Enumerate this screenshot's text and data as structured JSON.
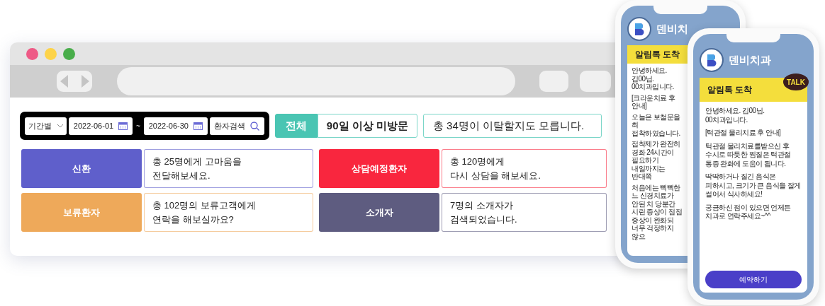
{
  "filter": {
    "period_select": "기간별",
    "start_date": "2022-06-01",
    "separator": "~",
    "end_date": "2022-06-30",
    "search_button": "환자검색"
  },
  "tabs": [
    {
      "label": "전체",
      "selected": true
    },
    {
      "label": "90일 이상 미방문",
      "selected": false
    }
  ],
  "summary": "총 34명이 이탈할지도 모릅니다.",
  "segments": [
    {
      "label": "신환",
      "color": "#5f5fcb",
      "message": "총 25명에게 고마움을\n전달해보세요."
    },
    {
      "label": "상담예정환자",
      "color": "#f9263e",
      "message": "총 120명에게\n다시 상담을 해보세요."
    },
    {
      "label": "보류환자",
      "color": "#eea95a",
      "message": "총 102명의 보류고객에게\n연락을 해보실까요?"
    },
    {
      "label": "소개자",
      "color": "#5e5c80",
      "message": "7명의 소개자가\n검색되었습니다."
    }
  ],
  "phones": [
    {
      "clinic": "덴비치",
      "banner": "알림톡 도착",
      "paragraphs": [
        "안녕하세요. 김00님. 00치과입니다.",
        "[크라운치료 후 안내]",
        "오늘은 보철문을 최 접착하였습니다.",
        "접착제가 완전히 경화 24시간이 필요하기 내일까지는 반대쪽",
        "처음에는 뻑뻑한 느 신경치료가 안된 치 당분간 시린 증상이 점점 증상이 완화되 너무 걱정하지 않으"
      ]
    },
    {
      "clinic": "덴비치과",
      "banner": "알림톡 도착",
      "talk_badge": "TALK",
      "paragraphs": [
        "안녕하세요. 김00님. 00치과입니다.",
        "[턱관절 물리치료 후 안내]",
        "턱관절 물리치료를받으신 후 수시로 따듯한 찜질은 턱관절 통증 완화에 도움이 됩니다.",
        "딱딱하거나 질긴 음식은 피하시고, 크기가 큰 음식을 잘게 썰어서 식사하세요!",
        "궁금하신 점이 있으면 언제든 치과로 연락주세요~^^"
      ],
      "button": "예약하기"
    }
  ]
}
